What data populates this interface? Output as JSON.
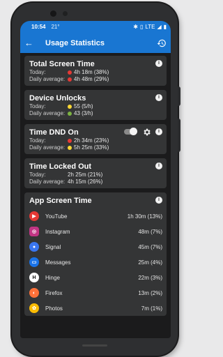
{
  "status": {
    "time": "10:54",
    "temp": "21°",
    "network": "LTE"
  },
  "appbar": {
    "title": "Usage Statistics",
    "back_icon": "arrow-left-icon",
    "history_icon": "history-icon"
  },
  "labels": {
    "today": "Today:",
    "daily": "Daily average:"
  },
  "cards": {
    "screen_time": {
      "title": "Total Screen Time",
      "today": "4h 18m (38%)",
      "daily": "4h 48m (29%)",
      "today_color": "#e53935",
      "daily_color": "#e53935"
    },
    "unlocks": {
      "title": "Device Unlocks",
      "today": "55 (5/h)",
      "daily": "43 (3/h)",
      "today_color": "#fdd835",
      "daily_color": "#7cb342"
    },
    "dnd": {
      "title": "Time DND On",
      "today": "2h 34m (23%)",
      "daily": "5h 25m (33%)",
      "today_color": "#e53935",
      "daily_color": "#fdd835"
    },
    "locked": {
      "title": "Time Locked Out",
      "today": "2h 25m (21%)",
      "daily": "4h 15m (26%)"
    }
  },
  "apps": {
    "title": "App Screen Time",
    "items": [
      {
        "name": "YouTube",
        "value": "1h 30m (13%)",
        "color": "#e53935",
        "icon": "youtube-icon"
      },
      {
        "name": "Instagram",
        "value": "48m (7%)",
        "color": "#c13584",
        "icon": "instagram-icon"
      },
      {
        "name": "Signal",
        "value": "45m (7%)",
        "color": "#3a76f0",
        "icon": "signal-icon"
      },
      {
        "name": "Messages",
        "value": "25m (4%)",
        "color": "#1a73e8",
        "icon": "messages-icon"
      },
      {
        "name": "Hinge",
        "value": "22m (3%)",
        "color": "#111111",
        "icon": "hinge-icon"
      },
      {
        "name": "Firefox",
        "value": "13m (2%)",
        "color": "#ff7139",
        "icon": "firefox-icon"
      },
      {
        "name": "Photos",
        "value": "7m (1%)",
        "color": "#fbbc04",
        "icon": "photos-icon"
      }
    ]
  }
}
